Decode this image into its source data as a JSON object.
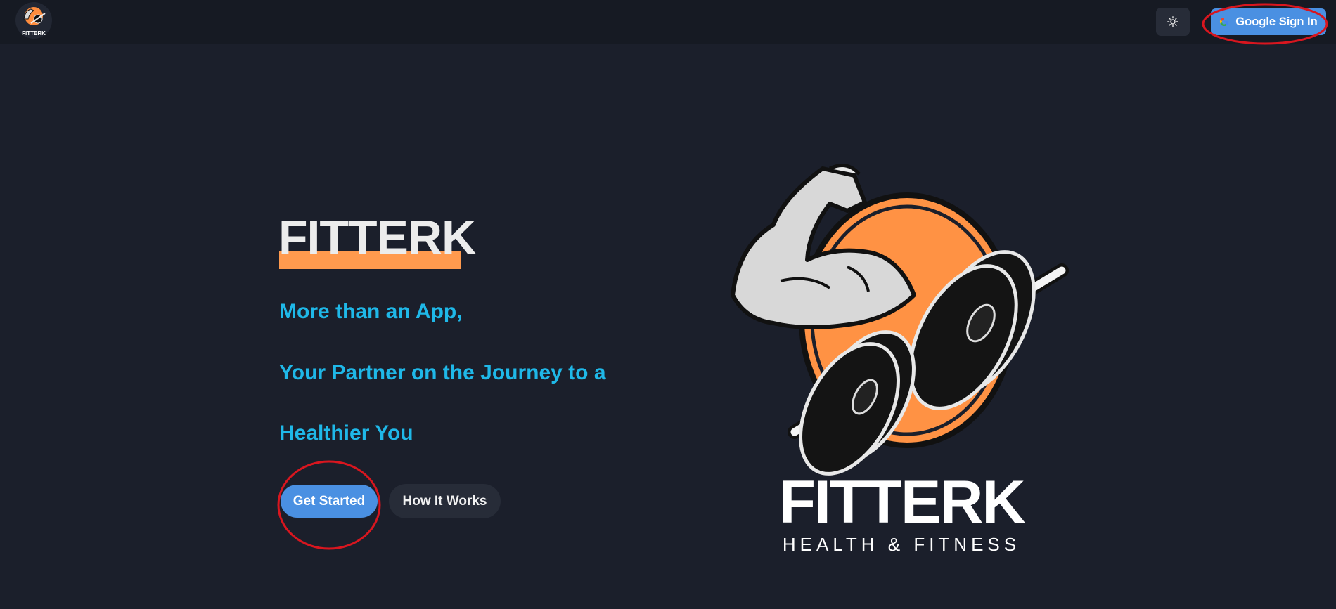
{
  "nav": {
    "logo_alt": "FITTERK",
    "google_signin_label": "Google Sign In"
  },
  "hero": {
    "title": "FITTERK",
    "tagline_1": "More than an App,",
    "tagline_2": "Your Partner on the Journey to a",
    "tagline_3": "Healthier You",
    "get_started_label": "Get Started",
    "how_it_works_label": "How It Works"
  },
  "logo": {
    "brand": "FITTERK",
    "subtitle": "HEALTH & FITNESS"
  },
  "colors": {
    "background": "#1b1f2b",
    "navbar": "#161a23",
    "primary_button": "#4a90e2",
    "secondary_button": "#272c38",
    "tagline": "#1fb8e8",
    "accent_orange": "#ff9a4e",
    "annotation_red": "#d9161f"
  },
  "icons": {
    "theme_toggle": "sun-icon",
    "google": "google-g-icon"
  }
}
